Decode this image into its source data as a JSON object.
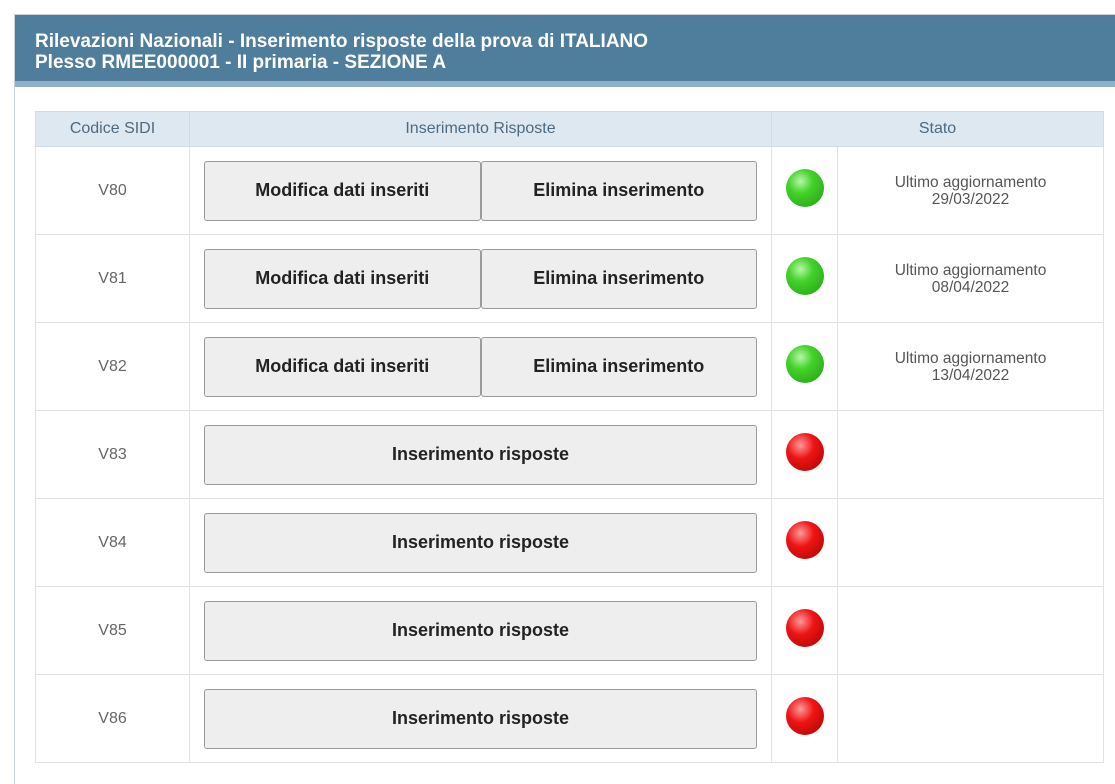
{
  "header": {
    "line1": "Rilevazioni Nazionali - Inserimento risposte della prova di ITALIANO",
    "line2": "Plesso RMEE000001 - II primaria - SEZIONE A"
  },
  "table": {
    "columns": [
      "Codice SIDI",
      "Inserimento Risposte",
      "Stato"
    ],
    "rows": [
      {
        "code": "V80",
        "status": "done",
        "updated_label": "Ultimo aggiornamento",
        "updated_date": "29/03/2022"
      },
      {
        "code": "V81",
        "status": "done",
        "updated_label": "Ultimo aggiornamento",
        "updated_date": "08/04/2022"
      },
      {
        "code": "V82",
        "status": "done",
        "updated_label": "Ultimo aggiornamento",
        "updated_date": "13/04/2022"
      },
      {
        "code": "V83",
        "status": "pending"
      },
      {
        "code": "V84",
        "status": "pending"
      },
      {
        "code": "V85",
        "status": "pending"
      },
      {
        "code": "V86",
        "status": "pending"
      }
    ]
  },
  "buttons": {
    "edit_label": "Modifica dati inseriti",
    "delete_label": "Elimina inserimento",
    "insert_label": "Inserimento risposte"
  },
  "colors": {
    "header_bg": "#4f7d9c",
    "status_done": "#2fbf1e",
    "status_pending": "#e01010"
  }
}
